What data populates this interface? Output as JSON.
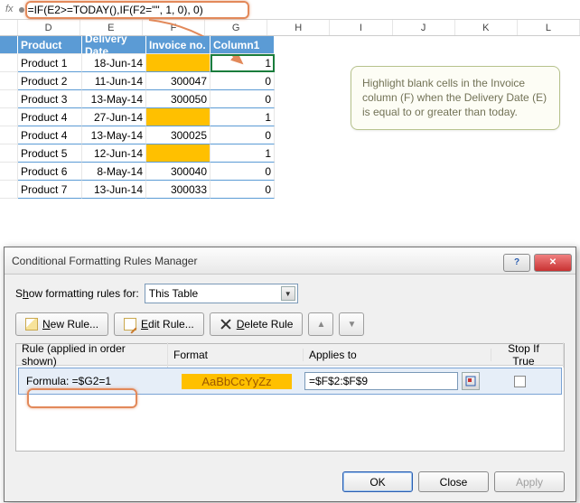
{
  "formula_bar": {
    "fx": "fx",
    "formula": "=IF(E2>=TODAY(),IF(F2=\"\", 1, 0), 0)"
  },
  "columns": [
    "D",
    "E",
    "F",
    "G",
    "H",
    "I",
    "J",
    "K",
    "L"
  ],
  "table_header": {
    "d": "Product",
    "e": "Delivery Date",
    "f": "Invoice no.",
    "g": "Column1"
  },
  "rows": [
    {
      "d": "Product 1",
      "e": "18-Jun-14",
      "f": "",
      "g": "1",
      "f_hl": true
    },
    {
      "d": "Product 2",
      "e": "11-Jun-14",
      "f": "300047",
      "g": "0"
    },
    {
      "d": "Product 3",
      "e": "13-May-14",
      "f": "300050",
      "g": "0"
    },
    {
      "d": "Product 4",
      "e": "27-Jun-14",
      "f": "",
      "g": "1",
      "f_hl": true
    },
    {
      "d": "Product 4",
      "e": "13-May-14",
      "f": "300025",
      "g": "0"
    },
    {
      "d": "Product 5",
      "e": "12-Jun-14",
      "f": "",
      "g": "1",
      "f_hl": true
    },
    {
      "d": "Product 6",
      "e": "8-May-14",
      "f": "300040",
      "g": "0"
    },
    {
      "d": "Product 7",
      "e": "13-Jun-14",
      "f": "300033",
      "g": "0"
    }
  ],
  "callout_text": "Highlight blank cells in the Invoice column (F) when the Delivery Date (E) is equal to or greater than today.",
  "dialog": {
    "title": "Conditional Formatting Rules Manager",
    "show_label_pre": "S",
    "show_label_u": "h",
    "show_label_post": "ow formatting rules for:",
    "scope": "This Table",
    "btn_new_u": "N",
    "btn_new": "ew Rule...",
    "btn_edit_u": "E",
    "btn_edit": "dit Rule...",
    "btn_del_u": "D",
    "btn_del": "elete Rule",
    "head_rule": "Rule (applied in order shown)",
    "head_format": "Format",
    "head_applies": "Applies to",
    "head_stop": "Stop If True",
    "rule_text": "Formula: =$G2=1",
    "sample": "AaBbCcYyZz",
    "applies_to": "=$F$2:$F$9",
    "ok": "OK",
    "close": "Close",
    "apply": "Apply"
  }
}
